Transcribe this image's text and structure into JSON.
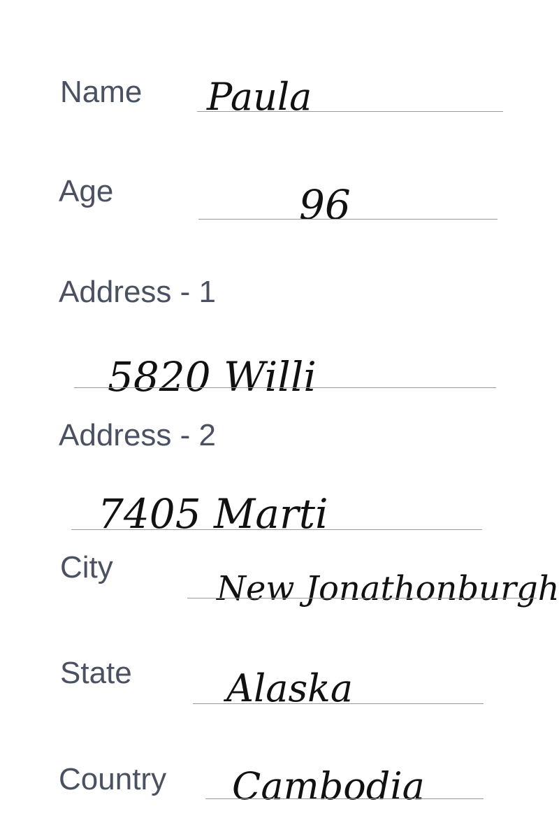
{
  "fields": {
    "name": {
      "label": "Name",
      "value": "Paula"
    },
    "age": {
      "label": "Age",
      "value": "96"
    },
    "address1": {
      "label": "Address - 1",
      "value": "5820 Willi"
    },
    "address2": {
      "label": "Address - 2",
      "value": "7405 Marti"
    },
    "city": {
      "label": "City",
      "value": "New Jonathonburgh"
    },
    "state": {
      "label": "State",
      "value": "Alaska"
    },
    "country": {
      "label": "Country",
      "value": "Cambodia"
    }
  },
  "colors": {
    "label": "#4a5261",
    "handwriting": "#111111",
    "underline": "#9a9a9a"
  }
}
